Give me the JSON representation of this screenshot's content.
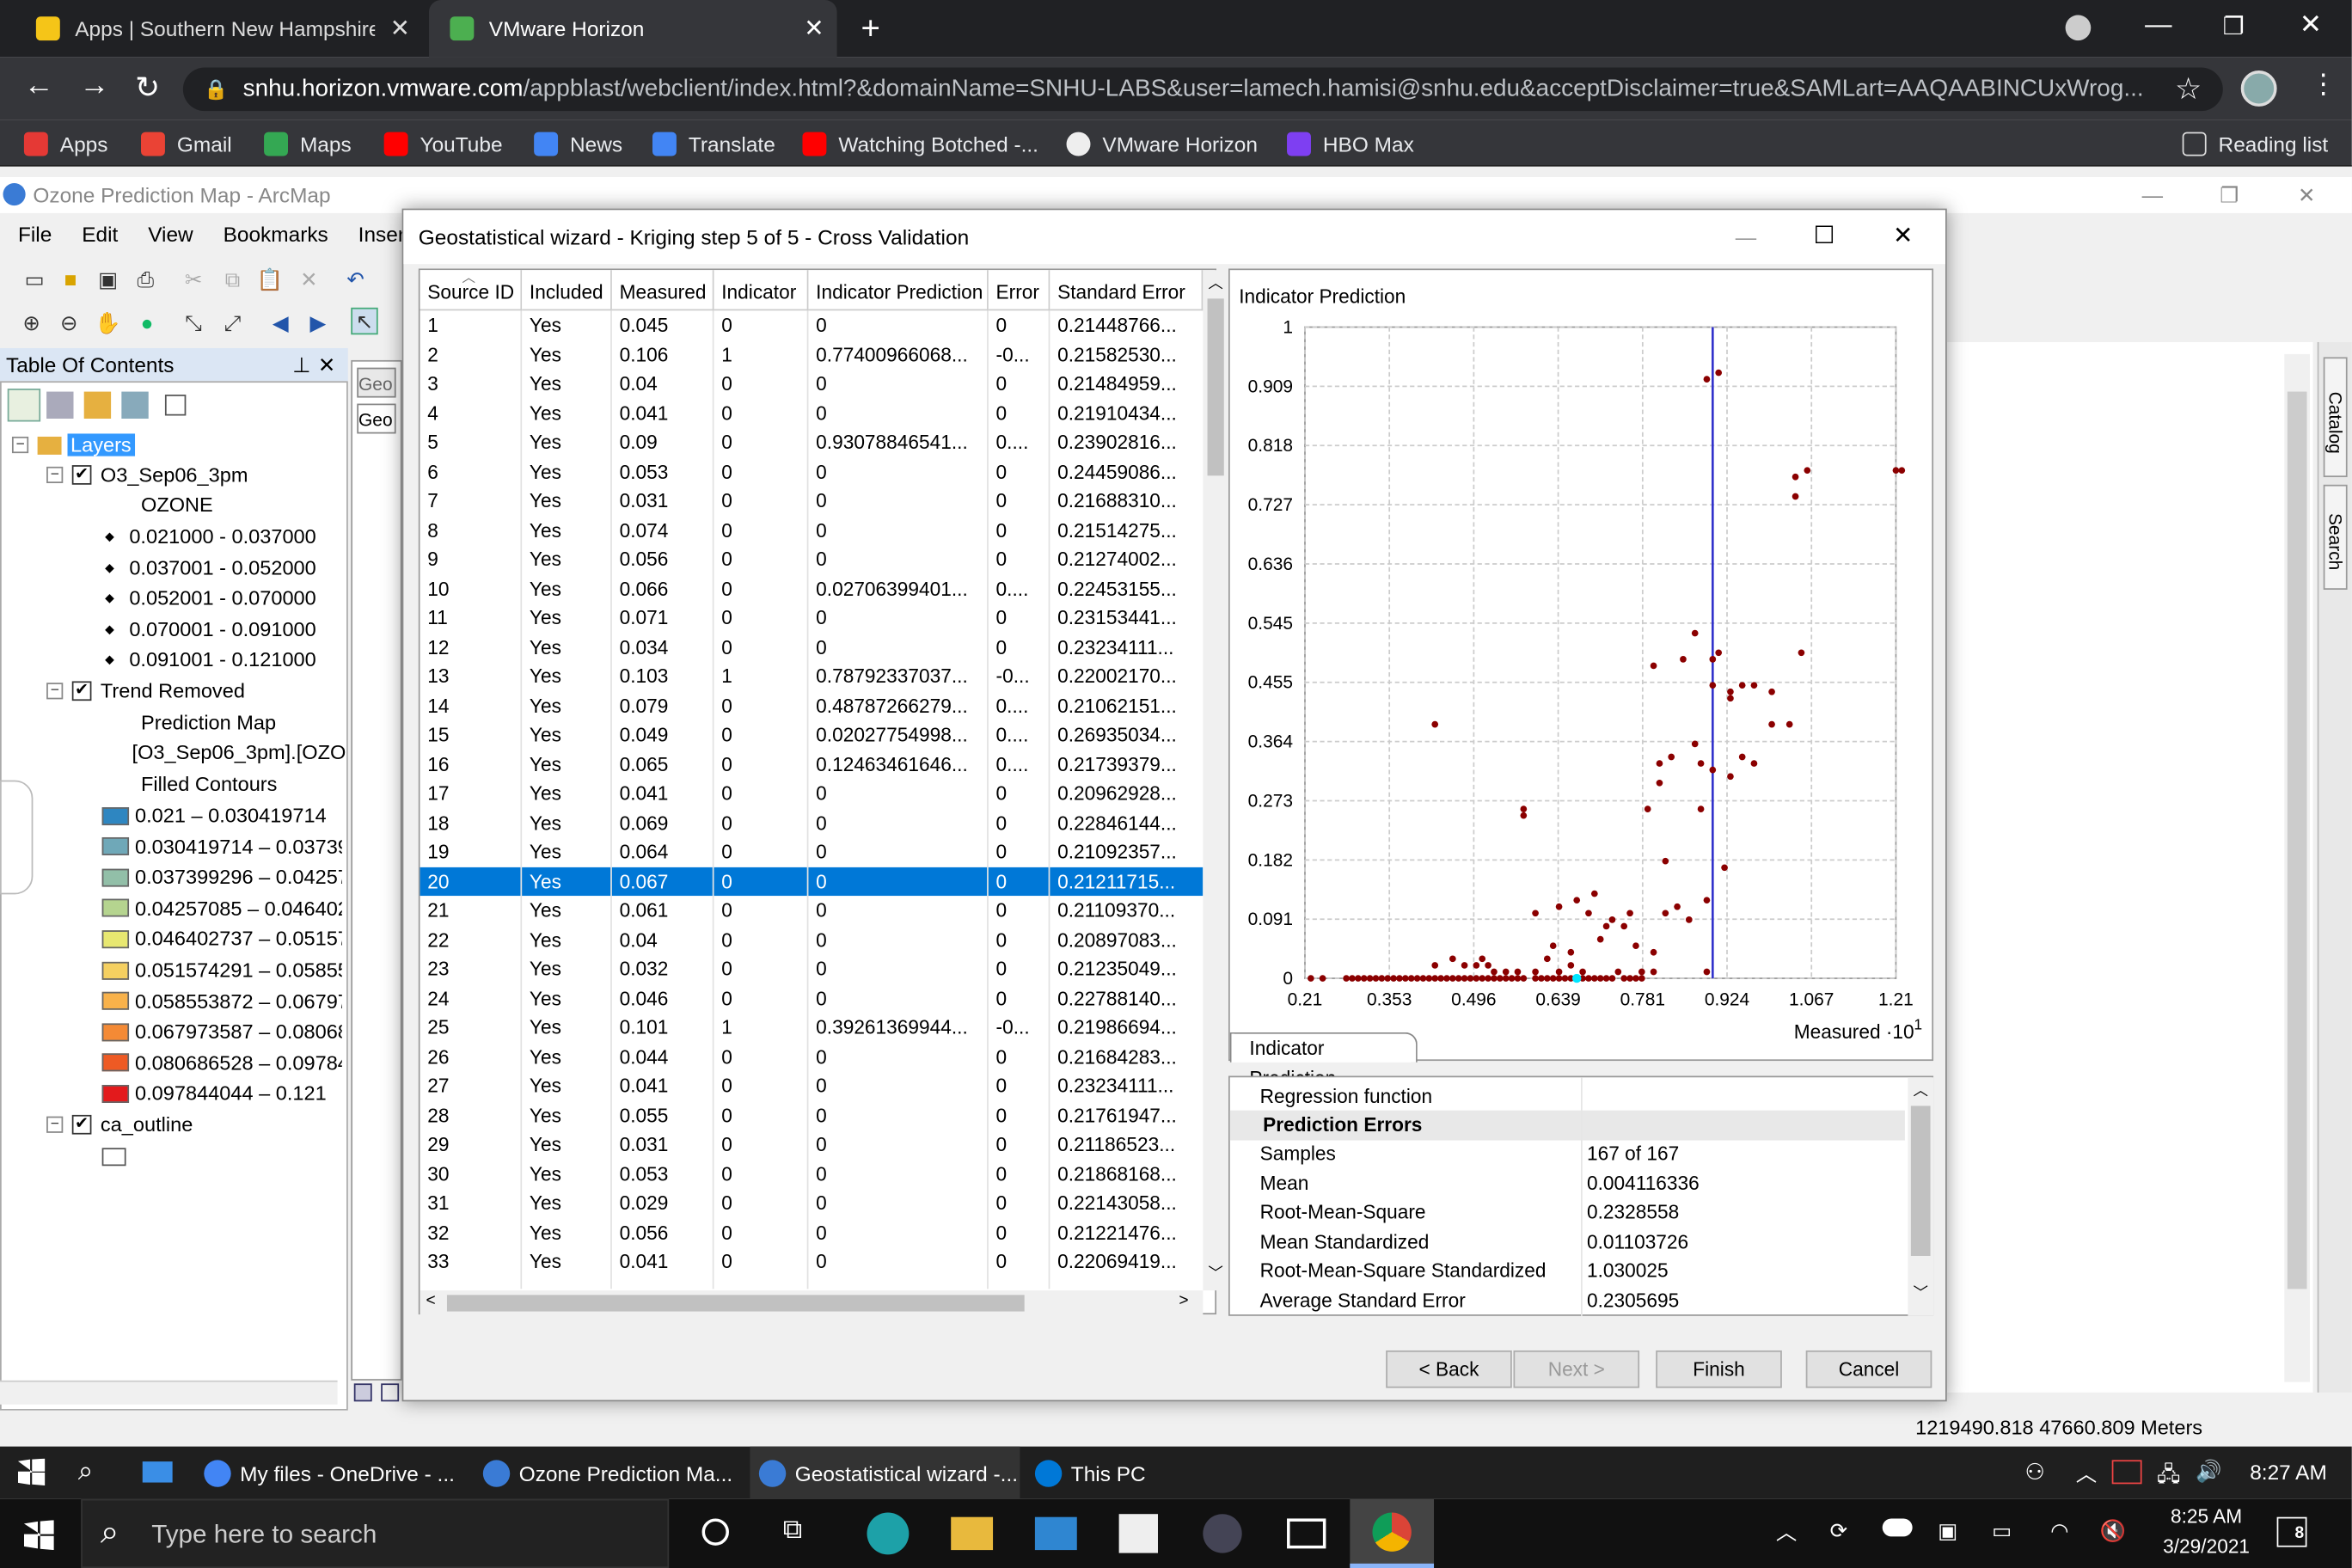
{
  "browser": {
    "tabs": [
      {
        "label": "Apps | Southern New Hampshire",
        "favicon_color": "#f5c518"
      },
      {
        "label": "VMware Horizon",
        "favicon_color": "#4caf50"
      }
    ],
    "url_host": "snhu.horizon.vmware.com",
    "url_path": "/appblast/webclient/index.html?&domainName=SNHU-LABS&user=lamech.hamisi@snhu.edu&acceptDisclaimer=true&SAMLart=AAQAABINCUxWrog...",
    "bookmarks": [
      {
        "label": "Apps",
        "color": "#e53935"
      },
      {
        "label": "Gmail",
        "color": "#ea4335"
      },
      {
        "label": "Maps",
        "color": "#34a853"
      },
      {
        "label": "YouTube",
        "color": "#ff0000"
      },
      {
        "label": "News",
        "color": "#4285f4"
      },
      {
        "label": "Translate",
        "color": "#4285f4"
      },
      {
        "label": "Watching Botched -...",
        "color": "#ff0000"
      },
      {
        "label": "VMware Horizon",
        "color": "#eeeeee"
      },
      {
        "label": "HBO Max",
        "color": "#7e3ff2"
      }
    ],
    "reading_list": "Reading list"
  },
  "arcmap": {
    "title": "Ozone Prediction Map - ArcMap",
    "menu": [
      "File",
      "Edit",
      "View",
      "Bookmarks",
      "Insert"
    ],
    "toc_title": "Table Of Contents",
    "layers_label": "Layers",
    "layer1": {
      "name": "O3_Sep06_3pm",
      "field": "OZONE",
      "classes": [
        "0.021000 - 0.037000",
        "0.037001 - 0.052000",
        "0.052001 - 0.070000",
        "0.070001 - 0.091000",
        "0.091001 - 0.121000"
      ]
    },
    "layer2": {
      "name": "Trend Removed",
      "sub1": "Prediction Map",
      "sub2": "[O3_Sep06_3pm].[OZO",
      "sub3": "Filled Contours",
      "classes": [
        {
          "label": "0.021 – 0.030419714",
          "color": "#2e86c1"
        },
        {
          "label": "0.030419714 – 0.037399",
          "color": "#6fa8b8"
        },
        {
          "label": "0.037399296 – 0.042570",
          "color": "#92bfa8"
        },
        {
          "label": "0.04257085 – 0.0464027",
          "color": "#b5d48f"
        },
        {
          "label": "0.046402737 – 0.051574",
          "color": "#e8e870"
        },
        {
          "label": "0.051574291 – 0.058553",
          "color": "#f5d060"
        },
        {
          "label": "0.058553872 – 0.067973",
          "color": "#f9b24a"
        },
        {
          "label": "0.067973587 – 0.080686",
          "color": "#f48a35"
        },
        {
          "label": "0.080686528 – 0.097844",
          "color": "#ee5a24"
        },
        {
          "label": "0.097844044 – 0.121",
          "color": "#e31a1c"
        }
      ]
    },
    "layer3": {
      "name": "ca_outline"
    },
    "tab_stubs": [
      "Geo",
      "Geo"
    ],
    "side_tabs": [
      "Catalog",
      "Search"
    ],
    "coords": "1219490.818  47660.809 Meters"
  },
  "dialog": {
    "title": "Geostatistical wizard - Kriging step 5 of 5 - Cross Validation",
    "columns": [
      "Source ID",
      "Included",
      "Measured",
      "Indicator",
      "Indicator Prediction",
      "Error",
      "Standard Error"
    ],
    "rows": [
      [
        "1",
        "Yes",
        "0.045",
        "0",
        "0",
        "0",
        "0.21448766..."
      ],
      [
        "2",
        "Yes",
        "0.106",
        "1",
        "0.77400966068...",
        "-0...",
        "0.21582530..."
      ],
      [
        "3",
        "Yes",
        "0.04",
        "0",
        "0",
        "0",
        "0.21484959..."
      ],
      [
        "4",
        "Yes",
        "0.041",
        "0",
        "0",
        "0",
        "0.21910434..."
      ],
      [
        "5",
        "Yes",
        "0.09",
        "0",
        "0.93078846541...",
        "0....",
        "0.23902816..."
      ],
      [
        "6",
        "Yes",
        "0.053",
        "0",
        "0",
        "0",
        "0.24459086..."
      ],
      [
        "7",
        "Yes",
        "0.031",
        "0",
        "0",
        "0",
        "0.21688310..."
      ],
      [
        "8",
        "Yes",
        "0.074",
        "0",
        "0",
        "0",
        "0.21514275..."
      ],
      [
        "9",
        "Yes",
        "0.056",
        "0",
        "0",
        "0",
        "0.21274002..."
      ],
      [
        "10",
        "Yes",
        "0.066",
        "0",
        "0.02706399401...",
        "0....",
        "0.22453155..."
      ],
      [
        "11",
        "Yes",
        "0.071",
        "0",
        "0",
        "0",
        "0.23153441..."
      ],
      [
        "12",
        "Yes",
        "0.034",
        "0",
        "0",
        "0",
        "0.23234111..."
      ],
      [
        "13",
        "Yes",
        "0.103",
        "1",
        "0.78792337037...",
        "-0...",
        "0.22002170..."
      ],
      [
        "14",
        "Yes",
        "0.079",
        "0",
        "0.48787266279...",
        "0....",
        "0.21062151..."
      ],
      [
        "15",
        "Yes",
        "0.049",
        "0",
        "0.02027754998...",
        "0....",
        "0.26935034..."
      ],
      [
        "16",
        "Yes",
        "0.065",
        "0",
        "0.12463461646...",
        "0....",
        "0.21739379..."
      ],
      [
        "17",
        "Yes",
        "0.041",
        "0",
        "0",
        "0",
        "0.20962928..."
      ],
      [
        "18",
        "Yes",
        "0.069",
        "0",
        "0",
        "0",
        "0.22846144..."
      ],
      [
        "19",
        "Yes",
        "0.064",
        "0",
        "0",
        "0",
        "0.21092357..."
      ],
      [
        "20",
        "Yes",
        "0.067",
        "0",
        "0",
        "0",
        "0.21211715..."
      ],
      [
        "21",
        "Yes",
        "0.061",
        "0",
        "0",
        "0",
        "0.21109370..."
      ],
      [
        "22",
        "Yes",
        "0.04",
        "0",
        "0",
        "0",
        "0.20897083..."
      ],
      [
        "23",
        "Yes",
        "0.032",
        "0",
        "0",
        "0",
        "0.21235049..."
      ],
      [
        "24",
        "Yes",
        "0.046",
        "0",
        "0",
        "0",
        "0.22788140..."
      ],
      [
        "25",
        "Yes",
        "0.101",
        "1",
        "0.39261369944...",
        "-0...",
        "0.21986694..."
      ],
      [
        "26",
        "Yes",
        "0.044",
        "0",
        "0",
        "0",
        "0.21684283..."
      ],
      [
        "27",
        "Yes",
        "0.041",
        "0",
        "0",
        "0",
        "0.23234111..."
      ],
      [
        "28",
        "Yes",
        "0.055",
        "0",
        "0",
        "0",
        "0.21761947..."
      ],
      [
        "29",
        "Yes",
        "0.031",
        "0",
        "0",
        "0",
        "0.21186523..."
      ],
      [
        "30",
        "Yes",
        "0.053",
        "0",
        "0",
        "0",
        "0.21868168..."
      ],
      [
        "31",
        "Yes",
        "0.029",
        "0",
        "0",
        "0",
        "0.22143058..."
      ],
      [
        "32",
        "Yes",
        "0.056",
        "0",
        "0",
        "0",
        "0.21221476..."
      ],
      [
        "33",
        "Yes",
        "0.041",
        "0",
        "0",
        "0",
        "0.22069419..."
      ]
    ],
    "selected_row": "20",
    "chart_tab": "Indicator Prediction",
    "stats": {
      "regression": "Regression function",
      "header": "Prediction Errors",
      "items": [
        [
          "Samples",
          "167 of 167"
        ],
        [
          "Mean",
          "0.004116336"
        ],
        [
          "Root-Mean-Square",
          "0.2328558"
        ],
        [
          "Mean Standardized",
          "0.01103726"
        ],
        [
          "Root-Mean-Square Standardized",
          "1.030025"
        ],
        [
          "Average Standard Error",
          "0.2305695"
        ]
      ]
    },
    "buttons": {
      "back": "< Back",
      "next": "Next >",
      "finish": "Finish",
      "cancel": "Cancel"
    }
  },
  "chart_data": {
    "type": "scatter",
    "title": "Indicator Prediction",
    "xlabel": "Measured ·10",
    "xlabel_exp": "1",
    "ylabel": "",
    "xlim": [
      0.21,
      1.21
    ],
    "ylim": [
      0,
      1
    ],
    "x_ticks": [
      "0.21",
      "0.353",
      "0.496",
      "0.639",
      "0.781",
      "0.924",
      "1.067",
      "1.21"
    ],
    "y_ticks": [
      "1",
      "0.909",
      "0.818",
      "0.727",
      "0.636",
      "0.545",
      "0.455",
      "0.364",
      "0.273",
      "0.182",
      "0.091",
      "0"
    ],
    "threshold_x": 0.9,
    "grid": true,
    "point_color": "#8b0000",
    "selected_point": [
      0.67,
      0
    ],
    "points": [
      [
        0.22,
        0
      ],
      [
        0.24,
        0
      ],
      [
        0.28,
        0
      ],
      [
        0.29,
        0
      ],
      [
        0.3,
        0
      ],
      [
        0.31,
        0
      ],
      [
        0.32,
        0
      ],
      [
        0.33,
        0
      ],
      [
        0.34,
        0
      ],
      [
        0.35,
        0
      ],
      [
        0.36,
        0
      ],
      [
        0.37,
        0
      ],
      [
        0.38,
        0
      ],
      [
        0.39,
        0
      ],
      [
        0.4,
        0
      ],
      [
        0.41,
        0
      ],
      [
        0.42,
        0
      ],
      [
        0.43,
        0
      ],
      [
        0.44,
        0
      ],
      [
        0.45,
        0
      ],
      [
        0.46,
        0
      ],
      [
        0.47,
        0
      ],
      [
        0.48,
        0
      ],
      [
        0.49,
        0
      ],
      [
        0.5,
        0
      ],
      [
        0.51,
        0
      ],
      [
        0.52,
        0
      ],
      [
        0.53,
        0
      ],
      [
        0.54,
        0
      ],
      [
        0.55,
        0
      ],
      [
        0.56,
        0
      ],
      [
        0.57,
        0
      ],
      [
        0.58,
        0
      ],
      [
        0.6,
        0
      ],
      [
        0.61,
        0
      ],
      [
        0.62,
        0
      ],
      [
        0.63,
        0
      ],
      [
        0.64,
        0
      ],
      [
        0.65,
        0
      ],
      [
        0.66,
        0
      ],
      [
        0.68,
        0
      ],
      [
        0.69,
        0
      ],
      [
        0.7,
        0
      ],
      [
        0.71,
        0
      ],
      [
        0.72,
        0
      ],
      [
        0.73,
        0
      ],
      [
        0.75,
        0
      ],
      [
        0.76,
        0
      ],
      [
        0.77,
        0
      ],
      [
        0.78,
        0
      ],
      [
        0.43,
        0.02
      ],
      [
        0.46,
        0.03
      ],
      [
        0.48,
        0.02
      ],
      [
        0.5,
        0.02
      ],
      [
        0.51,
        0.03
      ],
      [
        0.52,
        0.02
      ],
      [
        0.53,
        0.01
      ],
      [
        0.55,
        0.01
      ],
      [
        0.57,
        0.01
      ],
      [
        0.6,
        0.01
      ],
      [
        0.62,
        0.03
      ],
      [
        0.64,
        0.01
      ],
      [
        0.66,
        0.02
      ],
      [
        0.68,
        0.01
      ],
      [
        0.74,
        0.01
      ],
      [
        0.78,
        0.01
      ],
      [
        0.8,
        0.01
      ],
      [
        0.89,
        0.01
      ],
      [
        0.6,
        0.1
      ],
      [
        0.64,
        0.11
      ],
      [
        0.67,
        0.12
      ],
      [
        0.69,
        0.1
      ],
      [
        0.7,
        0.13
      ],
      [
        0.73,
        0.09
      ],
      [
        0.75,
        0.08
      ],
      [
        0.76,
        0.1
      ],
      [
        0.72,
        0.08
      ],
      [
        0.63,
        0.05
      ],
      [
        0.66,
        0.04
      ],
      [
        0.71,
        0.06
      ],
      [
        0.77,
        0.05
      ],
      [
        0.8,
        0.04
      ],
      [
        0.82,
        0.1
      ],
      [
        0.84,
        0.11
      ],
      [
        0.86,
        0.09
      ],
      [
        0.89,
        0.12
      ],
      [
        0.92,
        0.17
      ],
      [
        0.82,
        0.18
      ],
      [
        0.79,
        0.26
      ],
      [
        0.81,
        0.3
      ],
      [
        0.88,
        0.26
      ],
      [
        0.58,
        0.25
      ],
      [
        0.58,
        0.26
      ],
      [
        0.43,
        0.39
      ],
      [
        0.81,
        0.33
      ],
      [
        0.83,
        0.34
      ],
      [
        0.87,
        0.36
      ],
      [
        0.88,
        0.33
      ],
      [
        0.9,
        0.32
      ],
      [
        0.93,
        0.31
      ],
      [
        0.95,
        0.34
      ],
      [
        0.97,
        0.33
      ],
      [
        0.9,
        0.45
      ],
      [
        0.9,
        0.49
      ],
      [
        0.91,
        0.5
      ],
      [
        0.93,
        0.44
      ],
      [
        0.93,
        0.43
      ],
      [
        0.95,
        0.45
      ],
      [
        0.97,
        0.45
      ],
      [
        1.0,
        0.44
      ],
      [
        1.0,
        0.39
      ],
      [
        1.03,
        0.39
      ],
      [
        1.05,
        0.5
      ],
      [
        0.8,
        0.48
      ],
      [
        0.85,
        0.49
      ],
      [
        0.87,
        0.53
      ],
      [
        0.89,
        0.92
      ],
      [
        0.91,
        0.93
      ],
      [
        1.04,
        0.74
      ],
      [
        1.04,
        0.77
      ],
      [
        1.06,
        0.78
      ],
      [
        1.21,
        0.78
      ],
      [
        1.22,
        0.78
      ]
    ]
  },
  "taskbar": {
    "apps": [
      {
        "label": "My files - OneDrive - ...",
        "color": "#4285f4"
      },
      {
        "label": "Ozone Prediction Ma...",
        "color": "#3a7bd5"
      },
      {
        "label": "Geostatistical wizard -...",
        "color": "#3a7bd5"
      },
      {
        "label": "This PC",
        "color": "#0078d7"
      }
    ],
    "time1": "8:27 AM",
    "search_placeholder": "Type here to search",
    "time2": "8:25 AM",
    "date2": "3/29/2021",
    "notif_count": "8"
  }
}
